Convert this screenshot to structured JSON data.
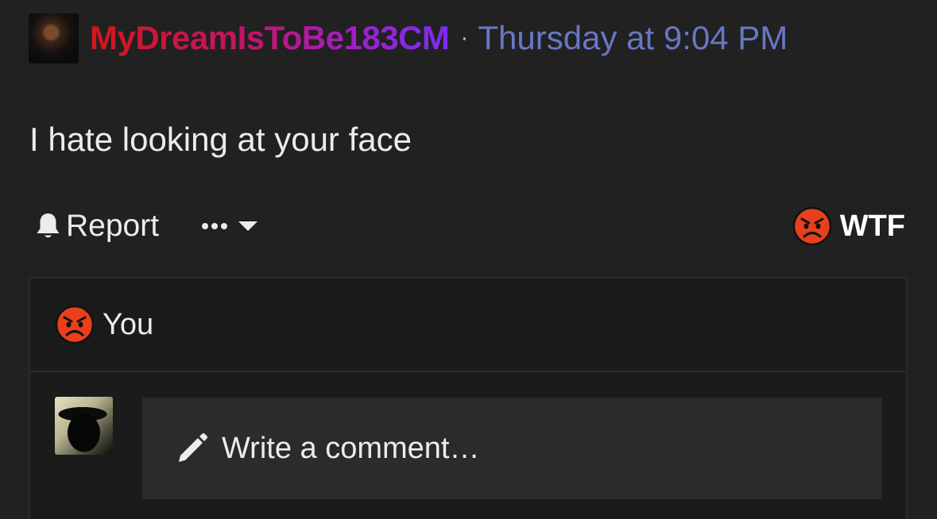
{
  "post": {
    "username": "MyDreamIsToBe183CM",
    "separator": "·",
    "timestamp": "Thursday at 9:04 PM",
    "message": "I hate looking at your face"
  },
  "actions": {
    "report_label": "Report",
    "more_icon": "ellipsis-icon",
    "dropdown_icon": "caret-down-icon",
    "reaction_icon": "angry-face-icon",
    "reaction_label": "WTF"
  },
  "reactions": {
    "icon": "angry-face-icon",
    "reactors_label": "You"
  },
  "comment": {
    "icon": "pencil-icon",
    "placeholder": "Write a comment…"
  },
  "colors": {
    "background": "#212121",
    "username_gradient_start": "#d11717",
    "username_gradient_end": "#7b2cf5",
    "timestamp": "#6877c4",
    "angry_face": "#e8401c"
  }
}
